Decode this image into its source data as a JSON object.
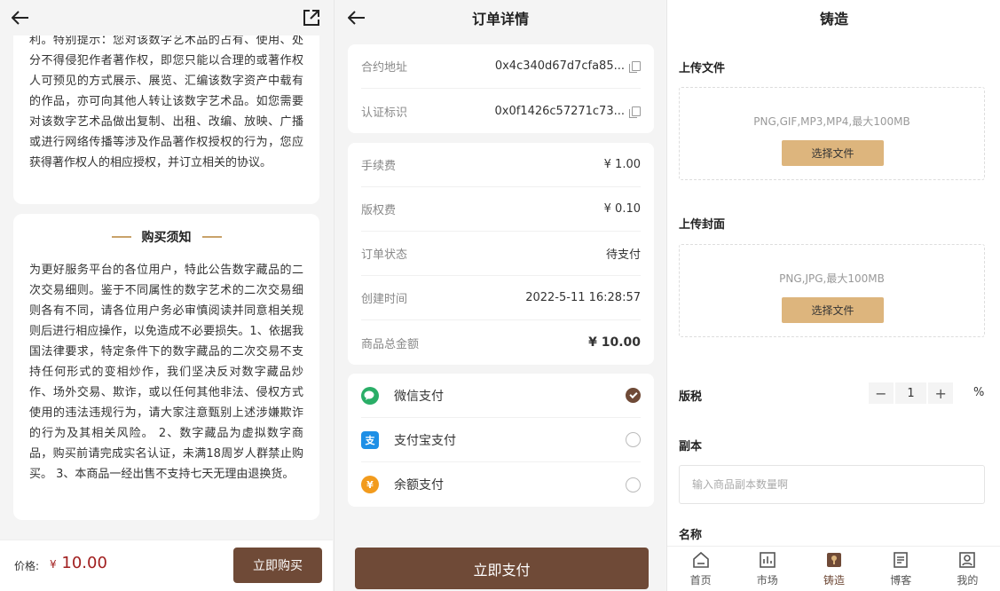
{
  "panel1": {
    "card1_text": "利。特别提示：您对该数字艺术品的占有、使用、处分不得侵犯作者著作权，即您只能以合理的或著作权人可预见的方式展示、展览、汇编该数字资产中载有的作品，亦可向其他人转让该数字艺术品。如您需要对该数字艺术品做出复制、出租、改编、放映、广播或进行网络传播等涉及作品著作权授权的行为，您应获得著作权人的相应授权，并订立相关的协议。",
    "notice_title": "购买须知",
    "notice_text": "为更好服务平台的各位用户，特此公告数字藏品的二次交易细则。鉴于不同属性的数字艺术的二次交易细则各有不同，请各位用户务必审慎阅读并同意相关规则后进行相应操作，以免造成不必要损失。1、依据我国法律要求，特定条件下的数字藏品的二次交易不支持任何形式的变相炒作，我们坚决反对数字藏品炒作、场外交易、欺诈，或以任何其他非法、侵权方式使用的违法违规行为，请大家注意甄别上述涉嫌欺诈的行为及其相关风险。 2、数字藏品为虚拟数字商品，购买前请完成实名认证，未满18周岁人群禁止购买。 3、本商品一经出售不支持七天无理由退换货。",
    "price_label": "价格:",
    "price_symbol": "¥",
    "price_value": "10.00",
    "buy_label": "立即购买"
  },
  "panel2": {
    "title": "订单详情",
    "contract_label": "合约地址",
    "contract_value": "0x4c340d67d7cfa85...",
    "cert_label": "认证标识",
    "cert_value": "0x0f1426c57271c73...",
    "fees": [
      {
        "label": "手续费",
        "value": "¥ 1.00"
      },
      {
        "label": "版权费",
        "value": "¥ 0.10"
      },
      {
        "label": "订单状态",
        "value": "待支付"
      },
      {
        "label": "创建时间",
        "value": "2022-5-11 16:28:57"
      },
      {
        "label": "商品总金额",
        "value": "¥ 10.00"
      }
    ],
    "payments": [
      {
        "label": "微信支付",
        "color": "#2aae67"
      },
      {
        "label": "支付宝支付",
        "color": "#1d8fe6"
      },
      {
        "label": "余额支付",
        "color": "#f29b1d"
      }
    ],
    "pay_btn": "立即支付"
  },
  "panel3": {
    "title": "铸造",
    "upload_file_label": "上传文件",
    "upload_file_hint": "PNG,GIF,MP3,MP4,最大100MB",
    "choose_file_1": "选择文件",
    "upload_cover_label": "上传封面",
    "upload_cover_hint": "PNG,JPG,最大100MB",
    "choose_file_2": "选择文件",
    "tax_label": "版税",
    "tax_value": "1",
    "tax_unit": "%",
    "copies_label": "副本",
    "copies_placeholder": "输入商品副本数量啊",
    "name_label": "名称",
    "tabs": [
      "首页",
      "市场",
      "铸造",
      "博客",
      "我的"
    ]
  },
  "colors": {
    "brand": "#6f4a37",
    "accent": "#ddb57d",
    "price": "#a11f1f"
  }
}
